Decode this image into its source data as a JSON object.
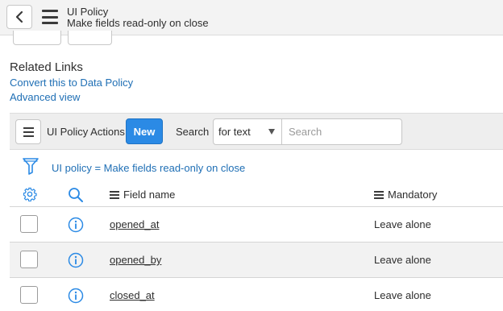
{
  "header": {
    "title": "UI Policy",
    "subtitle": "Make fields read-only on close"
  },
  "related_links": {
    "title": "Related Links",
    "links": [
      "Convert this to Data Policy",
      "Advanced view"
    ]
  },
  "list": {
    "title": "UI Policy Actions",
    "new_label": "New",
    "search_label": "Search",
    "search_field": "for text",
    "search_placeholder": "Search",
    "breadcrumb": "UI policy = Make fields read-only on close",
    "columns": [
      "Field name",
      "Mandatory"
    ],
    "rows": [
      {
        "field": "opened_at",
        "mandatory": "Leave alone"
      },
      {
        "field": "opened_by",
        "mandatory": "Leave alone"
      },
      {
        "field": "closed_at",
        "mandatory": "Leave alone"
      }
    ]
  },
  "colors": {
    "accent": "#2b8ae5",
    "link": "#1f6fb5",
    "header_bg": "#f3f3f3"
  },
  "icons": [
    "back-icon",
    "menu-icon",
    "filter-icon",
    "gear-icon",
    "search-icon",
    "info-icon"
  ]
}
